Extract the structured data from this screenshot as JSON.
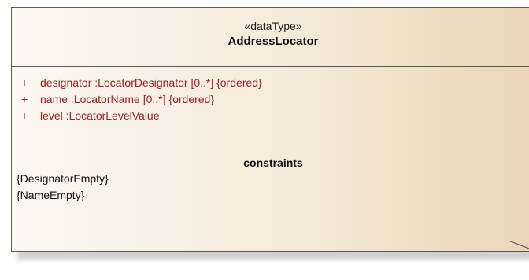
{
  "uml_class": {
    "stereotype": "«dataType»",
    "name": "AddressLocator",
    "attributes": [
      {
        "visibility": "+",
        "text": "designator  :LocatorDesignator [0..*] {ordered}"
      },
      {
        "visibility": "+",
        "text": "name  :LocatorName [0..*] {ordered}"
      },
      {
        "visibility": "+",
        "text": "level  :LocatorLevelValue"
      }
    ],
    "constraints_title": "constraints",
    "constraints": [
      "{DesignatorEmpty}",
      "{NameEmpty}"
    ]
  },
  "colors": {
    "attribute_text": "#9a2020",
    "border": "#5a5a5a",
    "fill_light": "#fbf7f1",
    "fill_dark": "#ead5b6"
  }
}
